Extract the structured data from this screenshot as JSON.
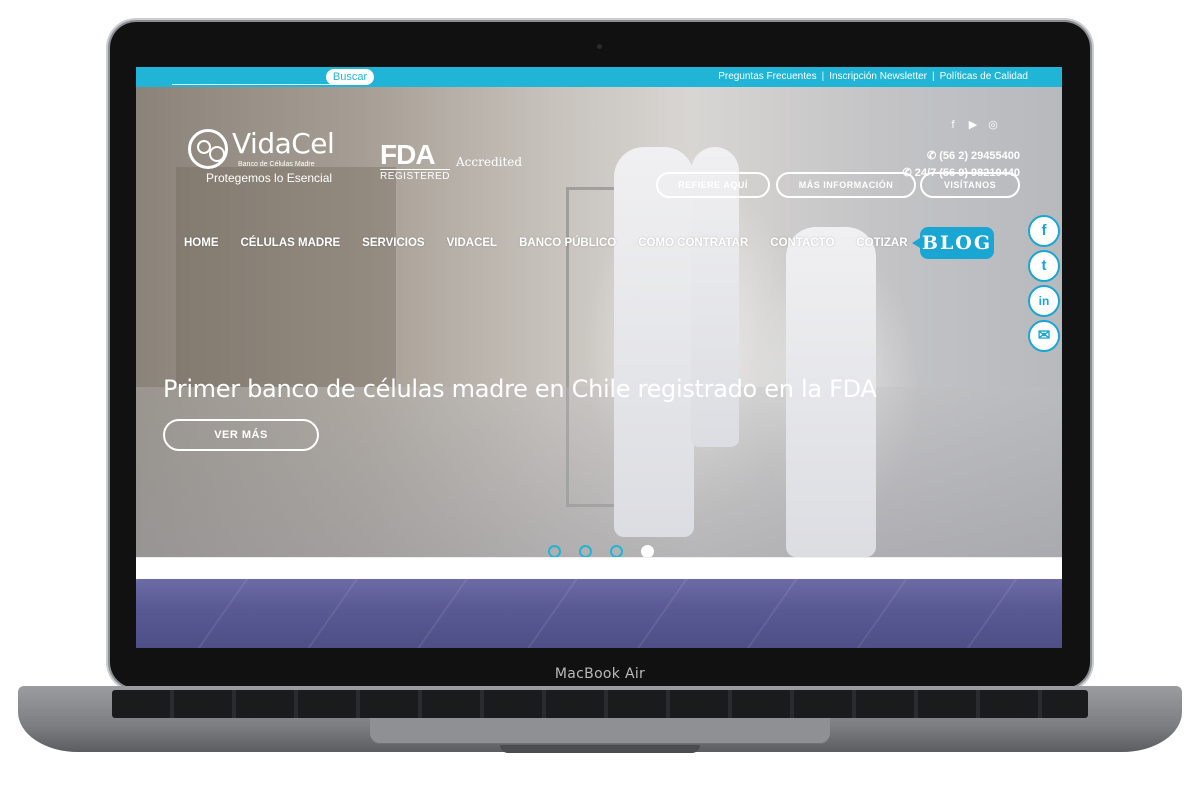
{
  "device": {
    "label": "MacBook Air"
  },
  "topbar": {
    "search_label": "Buscar",
    "links": [
      "Preguntas Frecuentes",
      "Inscripción Newsletter",
      "Políticas de Calidad"
    ],
    "separator": "|",
    "accent": "#20b5d6"
  },
  "brand": {
    "name": "VidaCel",
    "subtitle": "Banco de Células Madre",
    "tagline": "Protegemos lo Esencial",
    "fda_main": "FDA",
    "fda_sub": "REGISTERED",
    "accredited": "Accredited"
  },
  "contact": {
    "phone": "(56 2) 29455400",
    "phone_24": "24/7 (56 9) 98210440"
  },
  "social_top": [
    "facebook-icon",
    "youtube-icon",
    "instagram-icon"
  ],
  "cta_buttons": [
    "REFIERE AQUÍ",
    "MÁS INFORMACIÓN",
    "VISÍTANOS"
  ],
  "nav": {
    "items": [
      "HOME",
      "CÉLULAS MADRE",
      "SERVICIOS",
      "VIDACEL",
      "BANCO PÚBLICO",
      "CÓMO CONTRATAR",
      "CONTACTO",
      "COTIZAR"
    ],
    "blog": "BLOG"
  },
  "side_social": [
    "facebook-icon",
    "twitter-icon",
    "linkedin-icon",
    "email-icon"
  ],
  "hero": {
    "title": "Primer banco de células madre en Chile registrado en la FDA",
    "button": "VER MÁS",
    "slides": 4,
    "active_slide": 4
  }
}
